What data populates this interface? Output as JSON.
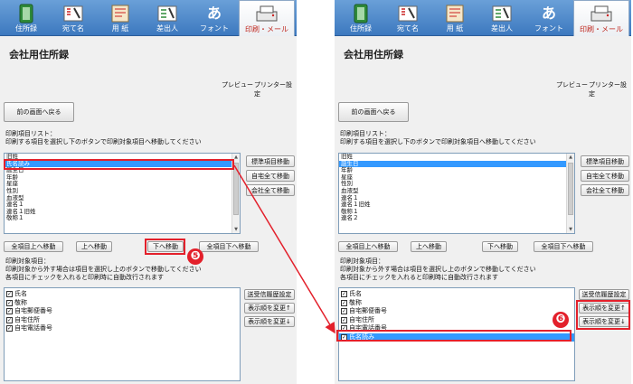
{
  "toolbar": {
    "items": [
      {
        "label": "住所録",
        "icon": "address-book-icon"
      },
      {
        "label": "宛て名",
        "icon": "addressee-icon"
      },
      {
        "label": "用 紙",
        "icon": "paper-icon"
      },
      {
        "label": "差出人",
        "icon": "sender-icon"
      },
      {
        "label": "フォント",
        "icon": "font-icon",
        "glyph": "あ"
      },
      {
        "label": "印刷・メール",
        "icon": "printer-mail-icon"
      }
    ]
  },
  "page_title": "会社用住所録",
  "links": {
    "preview": "プレビュー",
    "printer_settings": "プリンター設定"
  },
  "back_button": "前の画面へ戻る",
  "print_items": {
    "caption1": "印刷項目リスト：",
    "caption2": "印刷する項目を選択し下のボタンで印刷対象項目へ移動してください",
    "left_list": [
      "旧姓",
      "氏名読み",
      "誕生日",
      "年齢",
      "星座",
      "性別",
      "血液型",
      "連名１",
      "連名１旧姓",
      "敬称１"
    ],
    "right_list": [
      "旧姓",
      "誕生日",
      "年齢",
      "星座",
      "性別",
      "血液型",
      "連名１",
      "連名１旧姓",
      "敬称１",
      "連名２"
    ],
    "side_buttons": [
      "標準項目移動",
      "自宅全て移動",
      "会社全て移動"
    ]
  },
  "move_buttons": {
    "all_up": "全項目上へ移動",
    "up": "上へ移動",
    "down": "下へ移動",
    "all_down": "全項目下へ移動"
  },
  "target_items": {
    "caption1": "印刷対象項目：",
    "caption2": "印刷対象から外す場合は項目を選択し上のボタンで移動してください",
    "caption3": "各項目にチェックを入れると印刷時に自動改行されます",
    "left_list": [
      "氏名",
      "敬称",
      "自宅郵便番号",
      "自宅住所",
      "自宅電話番号"
    ],
    "right_list": [
      "氏名",
      "敬称",
      "自宅郵便番号",
      "自宅住所",
      "自宅電話番号",
      "氏名読み"
    ],
    "side_buttons": [
      "送受信履歴設定",
      "表示順を変更↑",
      "表示順を変更↓"
    ]
  },
  "callouts": {
    "step5": "❺",
    "step6": "❻"
  },
  "colors": {
    "accent": "#e3202b",
    "selection": "#3399ff",
    "toolbar": "#4a86c8"
  }
}
